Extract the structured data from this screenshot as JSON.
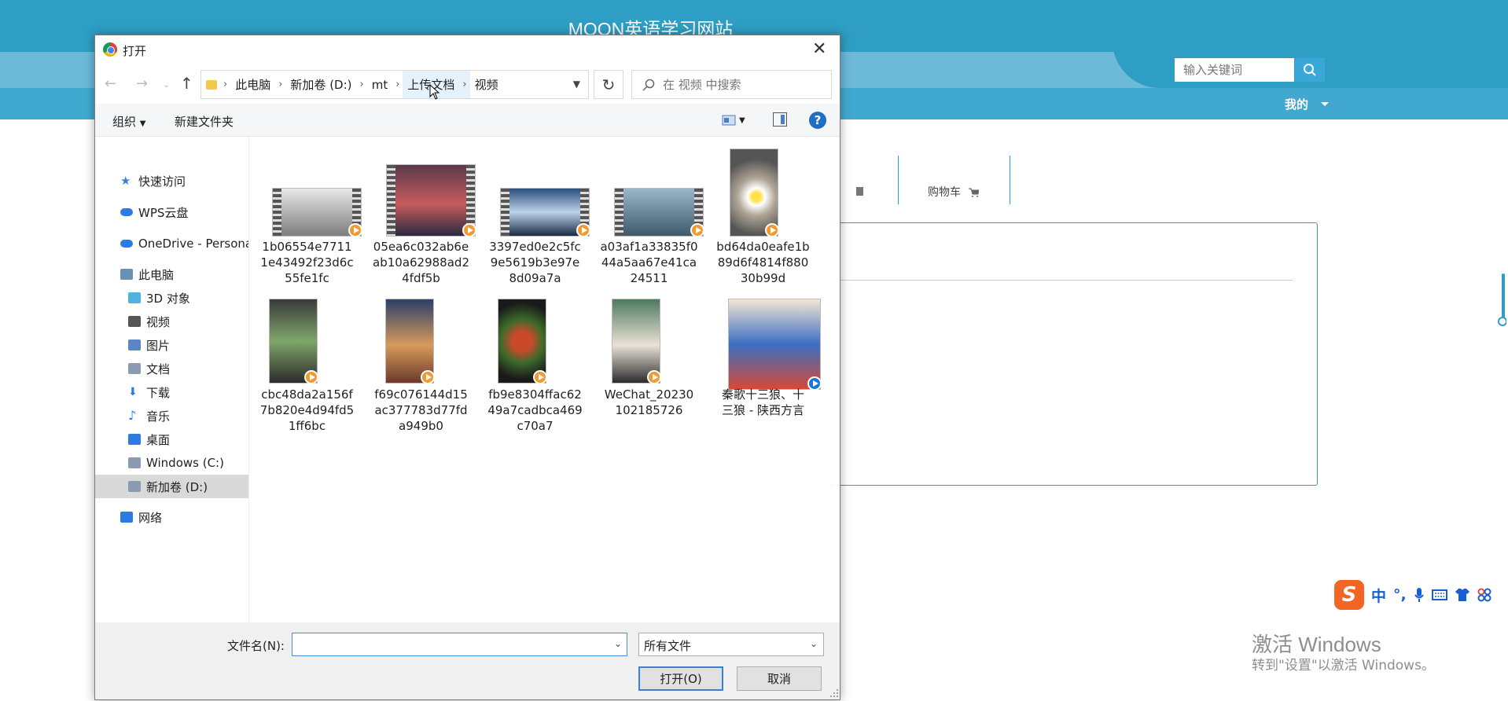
{
  "site": {
    "title": "MOON英语学习网站",
    "search_placeholder": "输入关键词",
    "my_menu": "我的",
    "cart_tab": "购物车",
    "accent_color": "#2e9ec4"
  },
  "activation": {
    "title": "激活 Windows",
    "subtitle": "转到\"设置\"以激活 Windows。"
  },
  "ime": {
    "items": [
      "中",
      "°,",
      "🎤",
      "⌨",
      "👕",
      "⚏"
    ]
  },
  "dialog": {
    "title": "打开",
    "close_icon": "close-icon",
    "breadcrumb": [
      "此电脑",
      "新加卷 (D:)",
      "mt",
      "上传文档",
      "视频"
    ],
    "search_placeholder": "在 视频 中搜索",
    "toolbar": {
      "organize": "组织",
      "new_folder": "新建文件夹",
      "help": "?"
    },
    "sidebar": [
      {
        "label": "快速访问",
        "icon": "star-icon"
      },
      {
        "label": "WPS云盘",
        "icon": "cloud-icon"
      },
      {
        "label": "OneDrive - Persona",
        "icon": "cloud-icon"
      },
      {
        "label": "此电脑",
        "icon": "computer-icon"
      },
      {
        "label": "3D 对象",
        "icon": "cube-icon"
      },
      {
        "label": "视频",
        "icon": "film-icon"
      },
      {
        "label": "图片",
        "icon": "image-icon"
      },
      {
        "label": "文档",
        "icon": "document-icon"
      },
      {
        "label": "下载",
        "icon": "download-icon"
      },
      {
        "label": "音乐",
        "icon": "music-icon"
      },
      {
        "label": "桌面",
        "icon": "desktop-icon"
      },
      {
        "label": "Windows (C:)",
        "icon": "drive-icon"
      },
      {
        "label": "新加卷 (D:)",
        "icon": "drive-icon",
        "selected": true
      },
      {
        "label": "网络",
        "icon": "network-icon"
      }
    ],
    "files": [
      {
        "name": "1b06554e7711 1e43492f23d6c 55fe1fc",
        "lines": [
          "1b06554e7711",
          "1e43492f23d6c",
          "55fe1fc"
        ]
      },
      {
        "name": "05ea6c032ab6e ab10a62988ad2 4fdf5b",
        "lines": [
          "05ea6c032ab6e",
          "ab10a62988ad2",
          "4fdf5b"
        ]
      },
      {
        "name": "3397ed0e2c5fc 9e5619b3e97e 8d09a7a",
        "lines": [
          "3397ed0e2c5fc",
          "9e5619b3e97e",
          "8d09a7a"
        ]
      },
      {
        "name": "a03af1a33835f0 44a5aa67e41ca 24511",
        "lines": [
          "a03af1a33835f0",
          "44a5aa67e41ca",
          "24511"
        ]
      },
      {
        "name": "bd64da0eafe1b 89d6f4814f880 30b99d",
        "lines": [
          "bd64da0eafe1b",
          "89d6f4814f880",
          "30b99d"
        ]
      },
      {
        "name": "cbc48da2a156f 7b820e4d94fd5 1ff6bc",
        "lines": [
          "cbc48da2a156f",
          "7b820e4d94fd5",
          "1ff6bc"
        ]
      },
      {
        "name": "f69c076144d15 ac377783d77fd a949b0",
        "lines": [
          "f69c076144d15",
          "ac377783d77fd",
          "a949b0"
        ]
      },
      {
        "name": "fb9e8304ffac62 49a7cadbca469 c70a7",
        "lines": [
          "fb9e8304ffac62",
          "49a7cadbca469",
          "c70a7"
        ]
      },
      {
        "name": "WeChat_20230 102185726",
        "lines": [
          "WeChat_20230",
          "102185726"
        ]
      },
      {
        "name": "秦歌十三狼、十 三狼 - 陕西方言",
        "lines": [
          "秦歌十三狼、十",
          "三狼 - 陕西方言"
        ]
      }
    ],
    "filename_label": "文件名(N):",
    "filename_value": "",
    "filetype": "所有文件",
    "open_button": "打开(O)",
    "cancel_button": "取消"
  }
}
